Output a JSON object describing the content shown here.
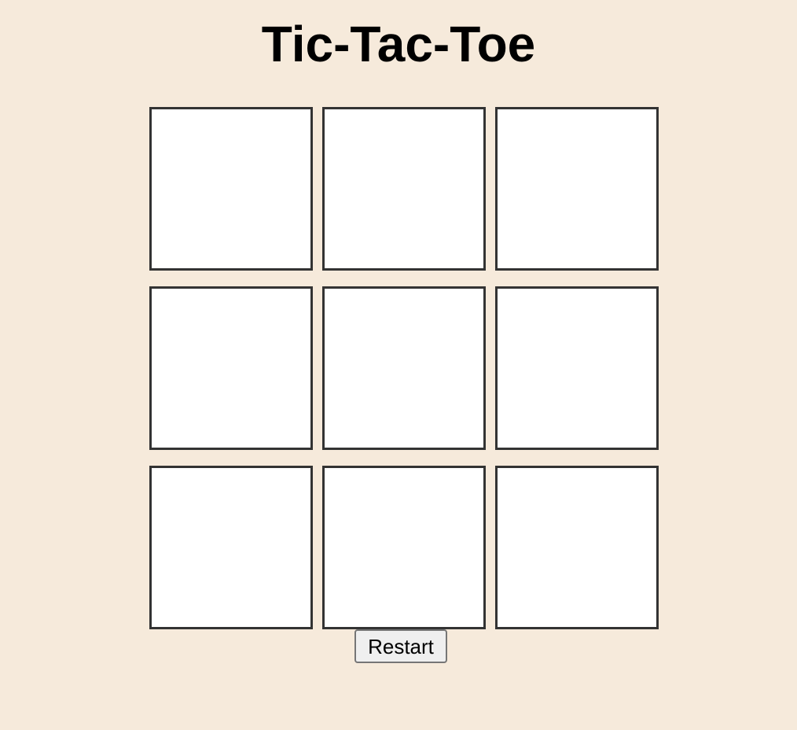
{
  "header": {
    "title": "Tic-Tac-Toe"
  },
  "board": {
    "cells": [
      "",
      "",
      "",
      "",
      "",
      "",
      "",
      "",
      ""
    ]
  },
  "controls": {
    "restart_label": "Restart"
  },
  "colors": {
    "background": "#f6eadb",
    "cell_background": "#ffffff",
    "cell_border": "#333333",
    "button_background": "#efefef",
    "button_border": "#767676"
  }
}
